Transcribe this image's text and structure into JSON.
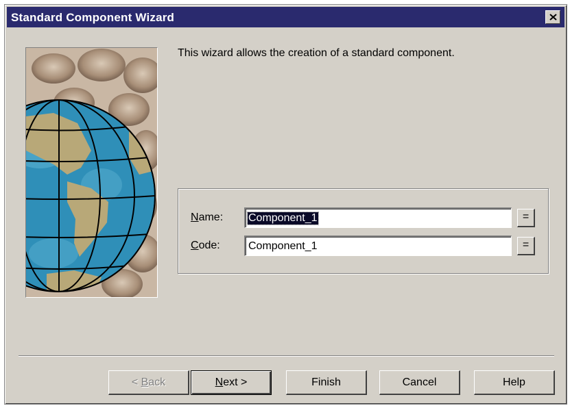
{
  "window": {
    "title": "Standard Component Wizard",
    "close_icon": "close-icon"
  },
  "intro_text": "This wizard allows the creation of a standard component.",
  "fields": {
    "name": {
      "label_mnemonic": "N",
      "label_rest": "ame:",
      "value": "Component_1",
      "selected": true,
      "eq_label": "="
    },
    "code": {
      "label_mnemonic": "C",
      "label_rest": "ode:",
      "value": "Component_1",
      "selected": false,
      "eq_label": "="
    }
  },
  "buttons": {
    "back": {
      "prefix": "< ",
      "mnemonic": "B",
      "rest": "ack",
      "enabled": false
    },
    "next": {
      "mnemonic": "N",
      "rest": "ext >",
      "default": true
    },
    "finish": "Finish",
    "cancel": "Cancel",
    "help": "Help"
  },
  "colors": {
    "titlebar": "#2a2a6e",
    "face": "#d4d0c8",
    "selection": "#0a0a28",
    "globe_ocean": "#2f8fb8",
    "globe_land": "#b8a878"
  }
}
